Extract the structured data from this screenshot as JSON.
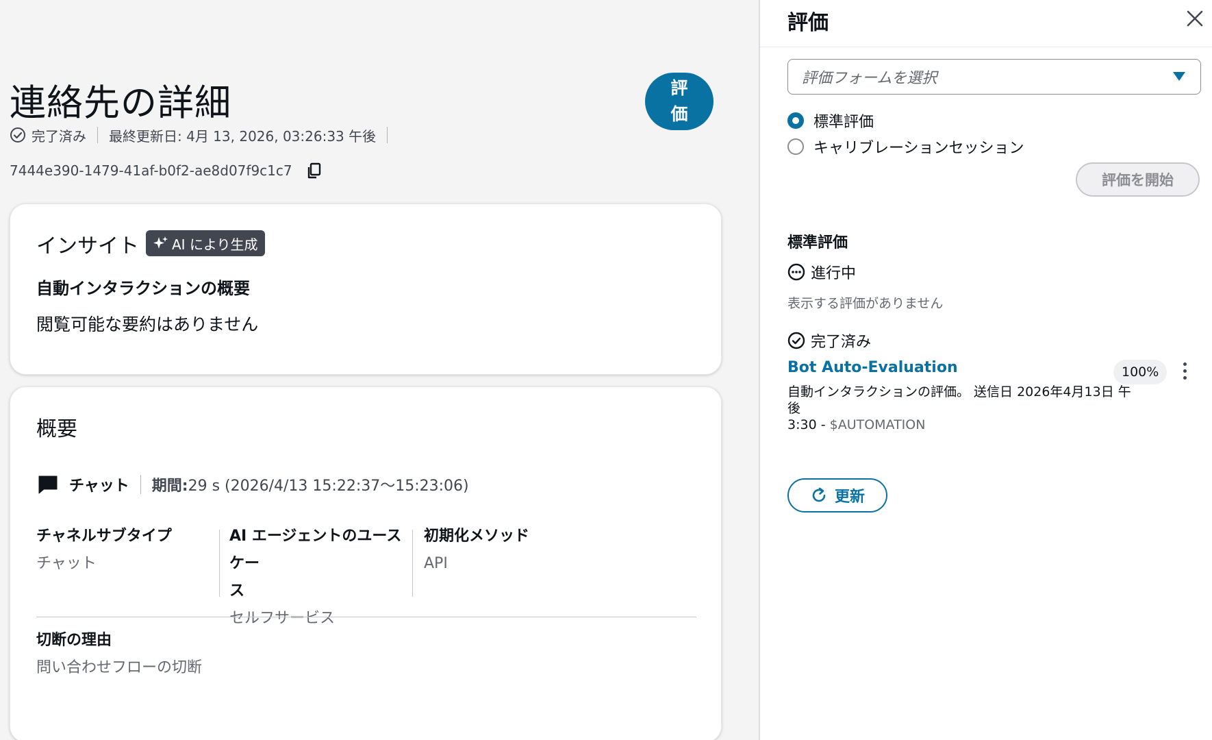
{
  "header": {
    "title": "連絡先の詳細",
    "evaluate_button_line1": "評",
    "evaluate_button_line2": "価",
    "status": "完了済み",
    "last_updated": "最終更新日: 4月 13, 2026, 03:26:33 午後",
    "contact_id": "7444e390-1479-41af-b0f2-ae8d07f9c1c7"
  },
  "insights": {
    "title": "インサイト",
    "ai_badge": "AI により生成",
    "summary_heading": "自動インタラクションの概要",
    "summary_text": "閲覧可能な要約はありません"
  },
  "overview": {
    "title": "概要",
    "channel": "チャット",
    "duration_label": "期間:",
    "duration_value": " 29 s (2026/4/13 15:22:37〜15:23:06)",
    "fields": [
      {
        "label": "チャネルサブタイプ",
        "value": "チャット"
      },
      {
        "label_line1": "AI エージェントのユースケー",
        "label_line2": "ス",
        "value": "セルフサービス"
      },
      {
        "label": "初期化メソッド",
        "value": "API"
      }
    ],
    "disconnect_label": "切断の理由",
    "disconnect_value": "問い合わせフローの切断"
  },
  "panel": {
    "title": "評価",
    "select_placeholder": "評価フォームを選択",
    "radio_standard": "標準評価",
    "radio_calibration": "キャリブレーションセッション",
    "start_button": "評価を開始",
    "section_title": "標準評価",
    "in_progress_label": "進行中",
    "no_evaluations": "表示する評価がありません",
    "completed_label": "完了済み",
    "item": {
      "name": "Bot Auto-Evaluation",
      "score": "100%",
      "desc_line1": "自動インタラクションの評価。 送信日 2026年4月13日 午後",
      "desc_line2_time": "3:30 - ",
      "desc_line2_user": "$AUTOMATION"
    },
    "refresh_button": "更新"
  },
  "colors": {
    "accent": "#0972a3",
    "text": "#0f141a",
    "muted": "#656871"
  }
}
